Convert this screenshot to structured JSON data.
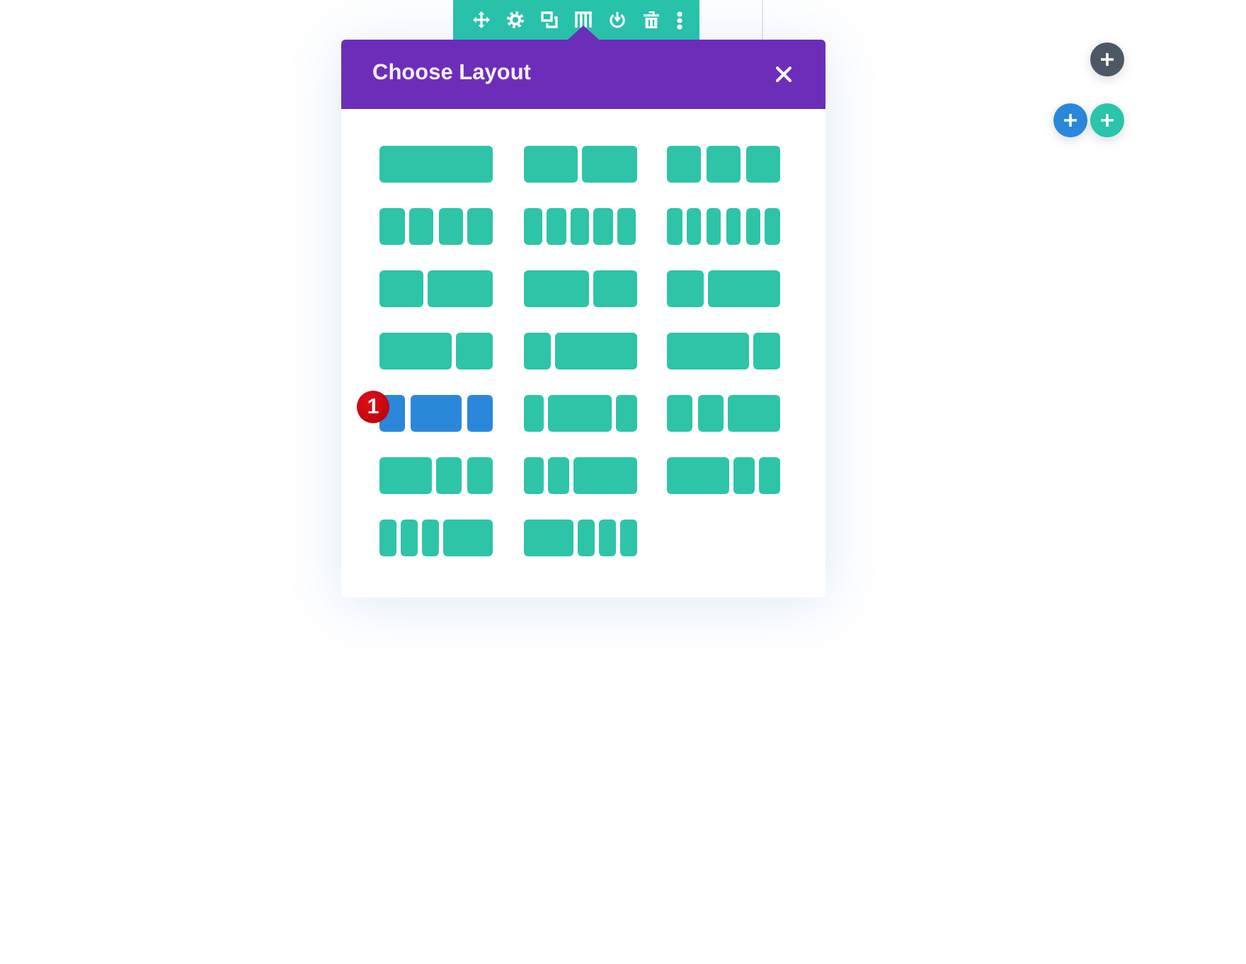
{
  "modal": {
    "title": "Choose Layout",
    "layouts": [
      {
        "kind": "full",
        "selected": false
      },
      {
        "kind": "halves",
        "selected": false
      },
      {
        "kind": "thirds",
        "selected": false
      },
      {
        "kind": "quarters",
        "selected": false
      },
      {
        "kind": "fifths",
        "selected": false
      },
      {
        "kind": "sixths",
        "selected": false
      },
      {
        "kind": "narrowwide",
        "selected": false
      },
      {
        "kind": "widenarrow",
        "selected": false
      },
      {
        "kind": "thirdtwothirds",
        "selected": false
      },
      {
        "kind": "twothirdsthird",
        "selected": false
      },
      {
        "kind": "quarterthreequarters",
        "selected": false
      },
      {
        "kind": "threequartersquarter",
        "selected": false
      },
      {
        "kind": "quarterhalfquarter",
        "selected": true,
        "badge": "1"
      },
      {
        "kind": "fifthwidefifth",
        "selected": false
      },
      {
        "kind": "quartersthenhalf",
        "selected": false
      },
      {
        "kind": "halfthenquarters",
        "selected": false
      },
      {
        "kind": "fifthsthenwide",
        "selected": false
      },
      {
        "kind": "widethenfifths",
        "selected": false
      },
      {
        "kind": "sixthsthenhalf",
        "selected": false
      },
      {
        "kind": "halfthensixths",
        "selected": false
      }
    ]
  },
  "add_buttons": [
    {
      "color": "#4c5866"
    },
    {
      "color": "#2b87da"
    },
    {
      "color": "#29c4a9"
    }
  ]
}
